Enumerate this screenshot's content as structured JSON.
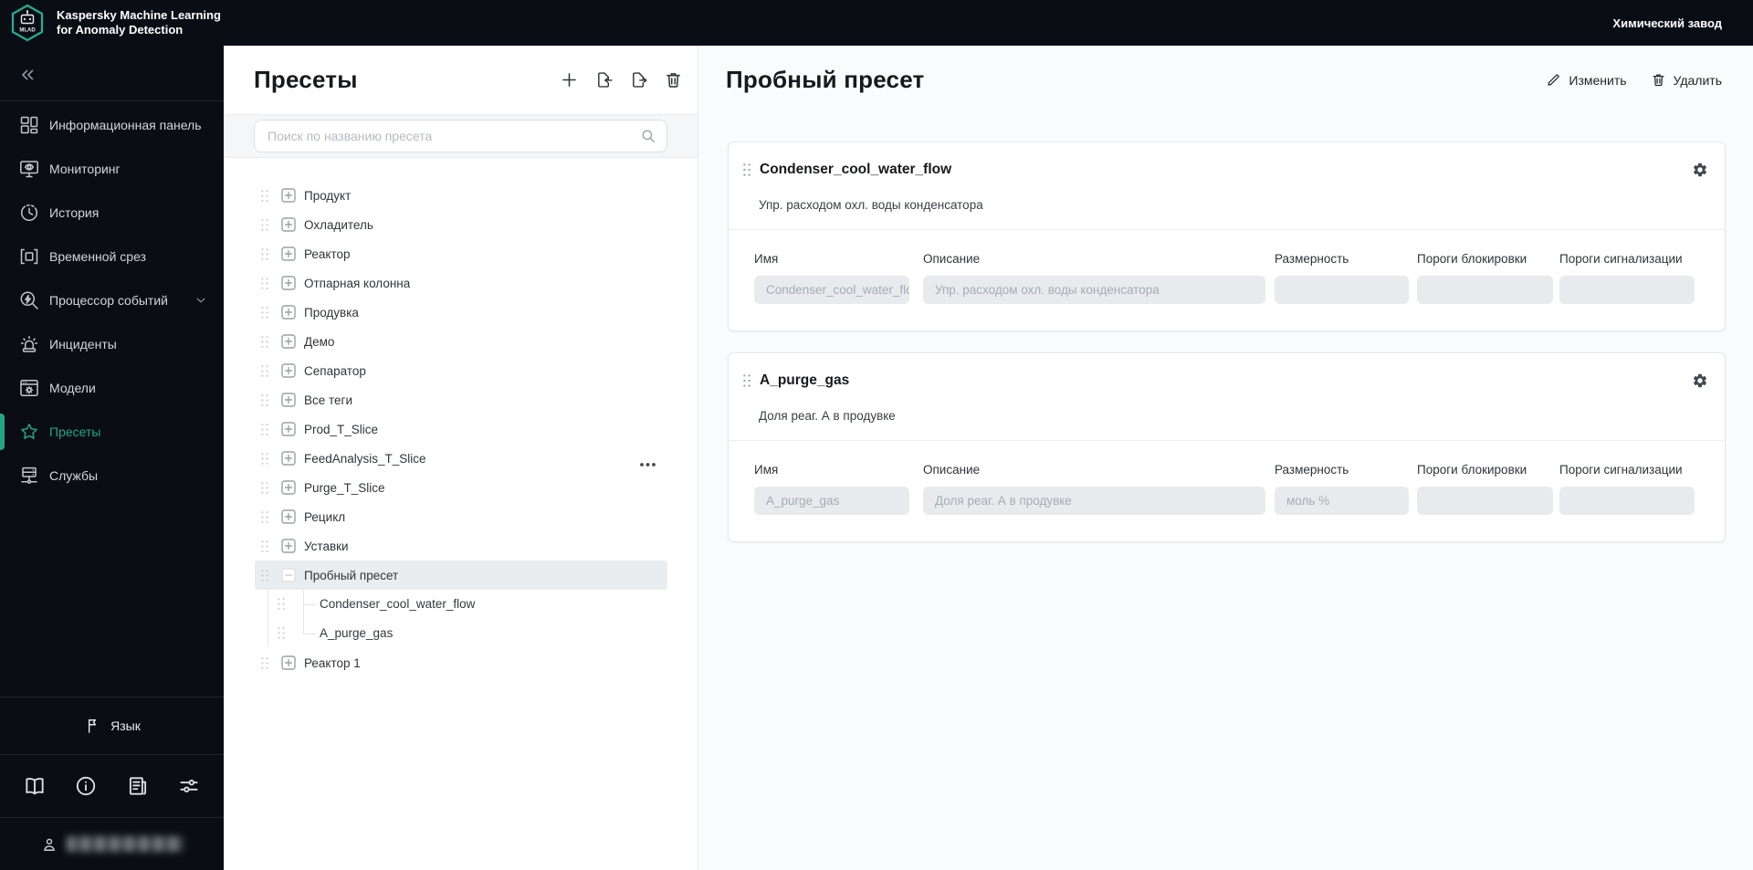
{
  "colors": {
    "accent": "#23a684",
    "sidebar_bg": "#0a0e14",
    "selected_row_bg": "#e9edf0",
    "field_bg": "#e8eaee"
  },
  "app": {
    "logo_text": "MLAD",
    "title_line1": "Kaspersky Machine Learning",
    "title_line2": "for Anomaly Detection",
    "topbar_right": "Химический завод"
  },
  "sidebar": {
    "collapse_icon": "double-chevron-left-icon",
    "items": [
      {
        "key": "dashboard",
        "label": "Информационная панель",
        "icon": "dashboard-icon"
      },
      {
        "key": "monitoring",
        "label": "Мониторинг",
        "icon": "monitoring-icon"
      },
      {
        "key": "history",
        "label": "История",
        "icon": "history-icon"
      },
      {
        "key": "time-slice",
        "label": "Временной срез",
        "icon": "time-slice-icon"
      },
      {
        "key": "event-processor",
        "label": "Процессор событий",
        "icon": "event-processor-icon",
        "has_chevron": true
      },
      {
        "key": "incidents",
        "label": "Инциденты",
        "icon": "incidents-icon"
      },
      {
        "key": "models",
        "label": "Модели",
        "icon": "models-icon"
      },
      {
        "key": "presets",
        "label": "Пресеты",
        "icon": "presets-icon",
        "active": true
      },
      {
        "key": "services",
        "label": "Службы",
        "icon": "services-icon"
      }
    ],
    "language_label": "Язык",
    "footer_icons": [
      "book-icon",
      "info-icon",
      "news-icon",
      "tune-icon"
    ],
    "user_icon": "person-icon"
  },
  "presets_panel": {
    "title": "Пресеты",
    "actions": [
      "add-preset-icon",
      "import-preset-icon",
      "export-preset-icon",
      "delete-preset-icon"
    ],
    "search_placeholder": "Поиск по названию пресета",
    "tree_items": [
      {
        "label": "Продукт"
      },
      {
        "label": "Охладитель"
      },
      {
        "label": "Реактор"
      },
      {
        "label": "Отпарная колонна"
      },
      {
        "label": "Продувка"
      },
      {
        "label": "Демо"
      },
      {
        "label": "Сепаратор"
      },
      {
        "label": "Все теги"
      },
      {
        "label": "Prod_T_Slice"
      },
      {
        "label": "FeedAnalysis_T_Slice",
        "menu": true
      },
      {
        "label": "Purge_T_Slice"
      },
      {
        "label": "Рецикл"
      },
      {
        "label": "Уставки"
      },
      {
        "label": "Пробный пресет",
        "selected": true,
        "expanded": true,
        "children": [
          "Condenser_cool_water_flow",
          "A_purge_gas"
        ]
      },
      {
        "label": "Реактор 1"
      }
    ]
  },
  "main": {
    "title": "Пробный пресет",
    "edit_label": "Изменить",
    "delete_label": "Удалить",
    "columns": [
      "Имя",
      "Описание",
      "Размерность",
      "Пороги блокировки",
      "Пороги сигнализации"
    ],
    "cards": [
      {
        "title": "Condenser_cool_water_flow",
        "description": "Упр. расходом охл. воды конденсатора",
        "values": [
          "Condenser_cool_water_flow",
          "Упр. расходом охл. воды конденсатора",
          "",
          "",
          ""
        ]
      },
      {
        "title": "A_purge_gas",
        "description": "Доля реаг. А в продувке",
        "values": [
          "A_purge_gas",
          "Доля реаг. А в продувке",
          "моль %",
          "",
          ""
        ]
      }
    ]
  }
}
